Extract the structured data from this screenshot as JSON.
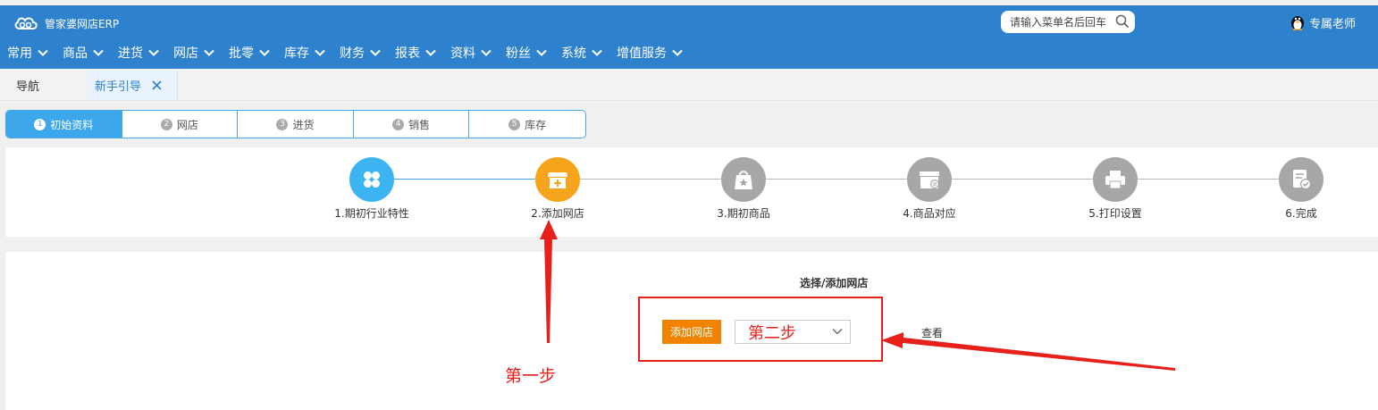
{
  "header": {
    "logo_text": "管家婆网店ERP",
    "search_placeholder": "请输入菜单名后回车",
    "user_label": "专属老师"
  },
  "menu": [
    {
      "label": "常用"
    },
    {
      "label": "商品"
    },
    {
      "label": "进货"
    },
    {
      "label": "网店"
    },
    {
      "label": "批零"
    },
    {
      "label": "库存"
    },
    {
      "label": "财务"
    },
    {
      "label": "报表"
    },
    {
      "label": "资料"
    },
    {
      "label": "粉丝"
    },
    {
      "label": "系统"
    },
    {
      "label": "增值服务"
    }
  ],
  "tabs": {
    "nav": "导航",
    "guide": "新手引导"
  },
  "steps": [
    {
      "num": "1",
      "label": "初始资料",
      "active": true
    },
    {
      "num": "2",
      "label": "网店"
    },
    {
      "num": "3",
      "label": "进货"
    },
    {
      "num": "4",
      "label": "销售"
    },
    {
      "num": "5",
      "label": "库存"
    }
  ],
  "progress": [
    {
      "label": "1.期初行业特性",
      "status": "done"
    },
    {
      "label": "2.添加网店",
      "status": "current"
    },
    {
      "label": "3.期初商品",
      "status": "todo"
    },
    {
      "label": "4.商品对应",
      "status": "todo"
    },
    {
      "label": "5.打印设置",
      "status": "todo"
    },
    {
      "label": "6.完成",
      "status": "todo"
    }
  ],
  "content": {
    "title": "选择/添加网店",
    "add_button": "添加网店",
    "select_value": "第二步",
    "view_link": "查看",
    "annotation_step1": "第一步"
  },
  "colors": {
    "header_bg": "#2e81cc",
    "accent_blue": "#3db4f2",
    "accent_orange": "#f5a41c",
    "button_orange": "#f08300",
    "annotation_red": "#e8201c"
  }
}
